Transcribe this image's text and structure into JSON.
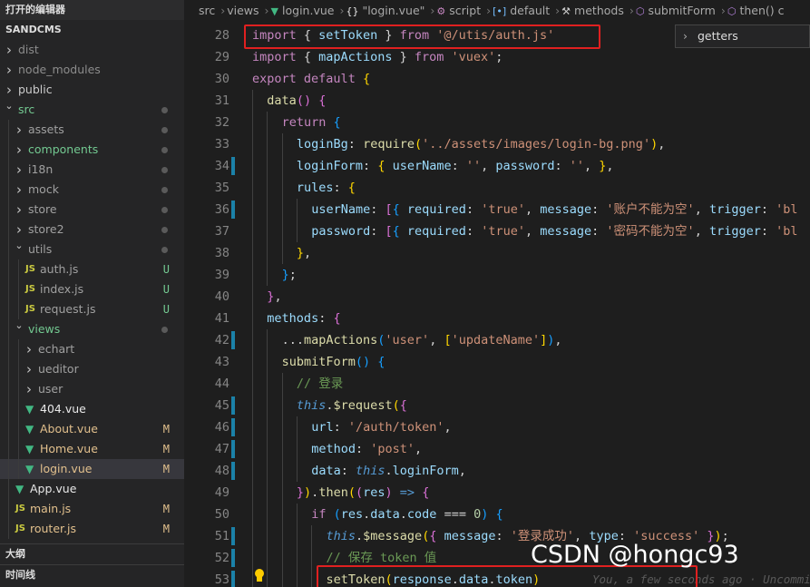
{
  "sidebar": {
    "open_editors": "打开的编辑器",
    "project": "SANDCMS",
    "items": [
      {
        "label": "dist",
        "kind": "folder",
        "depth": 0,
        "open": false,
        "color": "#8c8c8c",
        "status": ""
      },
      {
        "label": "node_modules",
        "kind": "folder",
        "depth": 0,
        "open": false,
        "color": "#8c8c8c",
        "status": ""
      },
      {
        "label": "public",
        "kind": "folder",
        "depth": 0,
        "open": false,
        "color": "#cccccc",
        "status": ""
      },
      {
        "label": "src",
        "kind": "folder",
        "depth": 0,
        "open": true,
        "color": "#73c991",
        "status": "dot"
      },
      {
        "label": "assets",
        "kind": "folder",
        "depth": 1,
        "open": false,
        "color": "#a0a0a0",
        "status": "dot"
      },
      {
        "label": "components",
        "kind": "folder",
        "depth": 1,
        "open": false,
        "color": "#73c991",
        "status": "dot"
      },
      {
        "label": "i18n",
        "kind": "folder",
        "depth": 1,
        "open": false,
        "color": "#a0a0a0",
        "status": "dot"
      },
      {
        "label": "mock",
        "kind": "folder",
        "depth": 1,
        "open": false,
        "color": "#a0a0a0",
        "status": "dot"
      },
      {
        "label": "store",
        "kind": "folder",
        "depth": 1,
        "open": false,
        "color": "#a0a0a0",
        "status": "dot"
      },
      {
        "label": "store2",
        "kind": "folder",
        "depth": 1,
        "open": false,
        "color": "#a0a0a0",
        "status": "dot"
      },
      {
        "label": "utils",
        "kind": "folder",
        "depth": 1,
        "open": true,
        "color": "#a0a0a0",
        "status": "dot"
      },
      {
        "label": "auth.js",
        "kind": "js",
        "depth": 2,
        "color": "#a0a0a0",
        "status": "U"
      },
      {
        "label": "index.js",
        "kind": "js",
        "depth": 2,
        "color": "#a0a0a0",
        "status": "U"
      },
      {
        "label": "request.js",
        "kind": "js",
        "depth": 2,
        "color": "#a0a0a0",
        "status": "U"
      },
      {
        "label": "views",
        "kind": "folder",
        "depth": 1,
        "open": true,
        "color": "#73c991",
        "status": "dot"
      },
      {
        "label": "echart",
        "kind": "folder",
        "depth": 2,
        "open": false,
        "color": "#a0a0a0",
        "status": ""
      },
      {
        "label": "ueditor",
        "kind": "folder",
        "depth": 2,
        "open": false,
        "color": "#a0a0a0",
        "status": ""
      },
      {
        "label": "user",
        "kind": "folder",
        "depth": 2,
        "open": false,
        "color": "#a0a0a0",
        "status": ""
      },
      {
        "label": "404.vue",
        "kind": "vue",
        "depth": 2,
        "color": "#e8e8e8",
        "status": ""
      },
      {
        "label": "About.vue",
        "kind": "vue",
        "depth": 2,
        "color": "#e2c08d",
        "status": "M"
      },
      {
        "label": "Home.vue",
        "kind": "vue",
        "depth": 2,
        "color": "#e2c08d",
        "status": "M"
      },
      {
        "label": "login.vue",
        "kind": "vue",
        "depth": 2,
        "color": "#e2c08d",
        "status": "M",
        "selected": true
      },
      {
        "label": "App.vue",
        "kind": "vue",
        "depth": 1,
        "color": "#e8e8e8",
        "status": ""
      },
      {
        "label": "main.js",
        "kind": "js",
        "depth": 1,
        "color": "#e2c08d",
        "status": "M"
      },
      {
        "label": "router.js",
        "kind": "js",
        "depth": 1,
        "color": "#e2c08d",
        "status": "M"
      }
    ],
    "outline": "大纲",
    "timeline": "时间线",
    "status_colors": {
      "U": "#73c991",
      "M": "#e2c08d"
    }
  },
  "breadcrumb": {
    "items": [
      {
        "text": "src",
        "icon": ""
      },
      {
        "text": "views",
        "icon": ""
      },
      {
        "text": "login.vue",
        "icon": "vue-icon"
      },
      {
        "text": "\"login.vue\"",
        "icon": "braces-icon"
      },
      {
        "text": "script",
        "icon": "script-icon"
      },
      {
        "text": "default",
        "icon": "object-icon"
      },
      {
        "text": "methods",
        "icon": "wrench-icon"
      },
      {
        "text": "submitForm",
        "icon": "cube-icon"
      },
      {
        "text": "then() c",
        "icon": "cube-icon"
      }
    ]
  },
  "suggest": {
    "label": "getters"
  },
  "editor": {
    "lines": [
      {
        "n": 28,
        "indent": 0,
        "mod": false,
        "t": [
          [
            "kw",
            "import"
          ],
          [
            "pun",
            " { "
          ],
          [
            "va",
            "setToken"
          ],
          [
            "pun",
            " } "
          ],
          [
            "kw",
            "from"
          ],
          [
            "pun",
            " "
          ],
          [
            "str",
            "'@/utis/auth.js'"
          ]
        ]
      },
      {
        "n": 29,
        "indent": 0,
        "mod": false,
        "t": [
          [
            "kw",
            "import"
          ],
          [
            "pun",
            " { "
          ],
          [
            "va",
            "mapActions"
          ],
          [
            "pun",
            " } "
          ],
          [
            "kw",
            "from"
          ],
          [
            "pun",
            " "
          ],
          [
            "str",
            "'vuex'"
          ],
          [
            "pun",
            ";"
          ]
        ]
      },
      {
        "n": 30,
        "indent": 0,
        "mod": false,
        "t": [
          [
            "kw",
            "export"
          ],
          [
            "pun",
            " "
          ],
          [
            "kw",
            "default"
          ],
          [
            "pun",
            " "
          ],
          [
            "br1",
            "{"
          ]
        ]
      },
      {
        "n": 31,
        "indent": 1,
        "mod": false,
        "t": [
          [
            "fn",
            "data"
          ],
          [
            "br2",
            "()"
          ],
          [
            "pun",
            " "
          ],
          [
            "br2",
            "{"
          ]
        ]
      },
      {
        "n": 32,
        "indent": 2,
        "mod": false,
        "t": [
          [
            "kw",
            "return"
          ],
          [
            "pun",
            " "
          ],
          [
            "br3",
            "{"
          ]
        ]
      },
      {
        "n": 33,
        "indent": 3,
        "mod": false,
        "t": [
          [
            "va",
            "loginBg"
          ],
          [
            "pun",
            ": "
          ],
          [
            "fn",
            "require"
          ],
          [
            "br1",
            "("
          ],
          [
            "str",
            "'../assets/images/login-bg.png'"
          ],
          [
            "br1",
            ")"
          ],
          [
            "pun",
            ","
          ]
        ]
      },
      {
        "n": 34,
        "indent": 3,
        "mod": true,
        "t": [
          [
            "va",
            "loginForm"
          ],
          [
            "pun",
            ": "
          ],
          [
            "br1",
            "{"
          ],
          [
            "pun",
            " "
          ],
          [
            "va",
            "userName"
          ],
          [
            "pun",
            ": "
          ],
          [
            "str",
            "''"
          ],
          [
            "pun",
            ", "
          ],
          [
            "va",
            "password"
          ],
          [
            "pun",
            ": "
          ],
          [
            "str",
            "''"
          ],
          [
            "pun",
            ", "
          ],
          [
            "br1",
            "}"
          ],
          [
            "pun",
            ","
          ]
        ]
      },
      {
        "n": 35,
        "indent": 3,
        "mod": false,
        "t": [
          [
            "va",
            "rules"
          ],
          [
            "pun",
            ": "
          ],
          [
            "br1",
            "{"
          ]
        ]
      },
      {
        "n": 36,
        "indent": 4,
        "mod": true,
        "t": [
          [
            "va",
            "userName"
          ],
          [
            "pun",
            ": "
          ],
          [
            "br2",
            "["
          ],
          [
            "br3",
            "{"
          ],
          [
            "pun",
            " "
          ],
          [
            "va",
            "required"
          ],
          [
            "pun",
            ": "
          ],
          [
            "str",
            "'true'"
          ],
          [
            "pun",
            ", "
          ],
          [
            "va",
            "message"
          ],
          [
            "pun",
            ": "
          ],
          [
            "str",
            "'账户不能为空'"
          ],
          [
            "pun",
            ", "
          ],
          [
            "va",
            "trigger"
          ],
          [
            "pun",
            ": "
          ],
          [
            "str",
            "'bl"
          ]
        ]
      },
      {
        "n": 37,
        "indent": 4,
        "mod": false,
        "t": [
          [
            "va",
            "password"
          ],
          [
            "pun",
            ": "
          ],
          [
            "br2",
            "["
          ],
          [
            "br3",
            "{"
          ],
          [
            "pun",
            " "
          ],
          [
            "va",
            "required"
          ],
          [
            "pun",
            ": "
          ],
          [
            "str",
            "'true'"
          ],
          [
            "pun",
            ", "
          ],
          [
            "va",
            "message"
          ],
          [
            "pun",
            ": "
          ],
          [
            "str",
            "'密码不能为空'"
          ],
          [
            "pun",
            ", "
          ],
          [
            "va",
            "trigger"
          ],
          [
            "pun",
            ": "
          ],
          [
            "str",
            "'bl"
          ]
        ]
      },
      {
        "n": 38,
        "indent": 3,
        "mod": false,
        "t": [
          [
            "br1",
            "}"
          ],
          [
            "pun",
            ","
          ]
        ]
      },
      {
        "n": 39,
        "indent": 2,
        "mod": false,
        "t": [
          [
            "br3",
            "}"
          ],
          [
            "pun",
            ";"
          ]
        ]
      },
      {
        "n": 40,
        "indent": 1,
        "mod": false,
        "t": [
          [
            "br2",
            "}"
          ],
          [
            "pun",
            ","
          ]
        ]
      },
      {
        "n": 41,
        "indent": 1,
        "mod": false,
        "t": [
          [
            "va",
            "methods"
          ],
          [
            "pun",
            ": "
          ],
          [
            "br2",
            "{"
          ]
        ]
      },
      {
        "n": 42,
        "indent": 2,
        "mod": true,
        "t": [
          [
            "pun",
            "..."
          ],
          [
            "fn",
            "mapActions"
          ],
          [
            "br3",
            "("
          ],
          [
            "str",
            "'user'"
          ],
          [
            "pun",
            ", "
          ],
          [
            "br1",
            "["
          ],
          [
            "str",
            "'updateName'"
          ],
          [
            "br1",
            "]"
          ],
          [
            "br3",
            ")"
          ],
          [
            "pun",
            ","
          ]
        ]
      },
      {
        "n": 43,
        "indent": 2,
        "mod": false,
        "t": [
          [
            "fn",
            "submitForm"
          ],
          [
            "br3",
            "()"
          ],
          [
            "pun",
            " "
          ],
          [
            "br3",
            "{"
          ]
        ]
      },
      {
        "n": 44,
        "indent": 3,
        "mod": false,
        "t": [
          [
            "cm",
            "// 登录"
          ]
        ]
      },
      {
        "n": 45,
        "indent": 3,
        "mod": true,
        "t": [
          [
            "this",
            "this"
          ],
          [
            "pun",
            "."
          ],
          [
            "fn",
            "$request"
          ],
          [
            "br1",
            "("
          ],
          [
            "br2",
            "{"
          ]
        ]
      },
      {
        "n": 46,
        "indent": 4,
        "mod": true,
        "t": [
          [
            "va",
            "url"
          ],
          [
            "pun",
            ": "
          ],
          [
            "str",
            "'/auth/token'"
          ],
          [
            "pun",
            ","
          ]
        ]
      },
      {
        "n": 47,
        "indent": 4,
        "mod": true,
        "t": [
          [
            "va",
            "method"
          ],
          [
            "pun",
            ": "
          ],
          [
            "str",
            "'post'"
          ],
          [
            "pun",
            ","
          ]
        ]
      },
      {
        "n": 48,
        "indent": 4,
        "mod": true,
        "t": [
          [
            "va",
            "data"
          ],
          [
            "pun",
            ": "
          ],
          [
            "this",
            "this"
          ],
          [
            "pun",
            "."
          ],
          [
            "va",
            "loginForm"
          ],
          [
            "pun",
            ","
          ]
        ]
      },
      {
        "n": 49,
        "indent": 3,
        "mod": false,
        "t": [
          [
            "br2",
            "}"
          ],
          [
            "br1",
            ")"
          ],
          [
            "pun",
            "."
          ],
          [
            "fn",
            "then"
          ],
          [
            "br1",
            "("
          ],
          [
            "br2",
            "("
          ],
          [
            "va",
            "res"
          ],
          [
            "br2",
            ")"
          ],
          [
            "pun",
            " "
          ],
          [
            "bl",
            "=>"
          ],
          [
            "pun",
            " "
          ],
          [
            "br2",
            "{"
          ]
        ]
      },
      {
        "n": 50,
        "indent": 4,
        "mod": false,
        "t": [
          [
            "kw",
            "if"
          ],
          [
            "pun",
            " "
          ],
          [
            "br3",
            "("
          ],
          [
            "va",
            "res"
          ],
          [
            "pun",
            "."
          ],
          [
            "va",
            "data"
          ],
          [
            "pun",
            "."
          ],
          [
            "va",
            "code"
          ],
          [
            "pun",
            " === "
          ],
          [
            "num",
            "0"
          ],
          [
            "br3",
            ")"
          ],
          [
            "pun",
            " "
          ],
          [
            "br3",
            "{"
          ]
        ]
      },
      {
        "n": 51,
        "indent": 5,
        "mod": true,
        "t": [
          [
            "this",
            "this"
          ],
          [
            "pun",
            "."
          ],
          [
            "fn",
            "$message"
          ],
          [
            "br1",
            "("
          ],
          [
            "br2",
            "{"
          ],
          [
            "pun",
            " "
          ],
          [
            "va",
            "message"
          ],
          [
            "pun",
            ": "
          ],
          [
            "str",
            "'登录成功'"
          ],
          [
            "pun",
            ", "
          ],
          [
            "va",
            "type"
          ],
          [
            "pun",
            ": "
          ],
          [
            "str",
            "'success'"
          ],
          [
            "pun",
            " "
          ],
          [
            "br2",
            "}"
          ],
          [
            "br1",
            ")"
          ],
          [
            "pun",
            ";"
          ]
        ]
      },
      {
        "n": 52,
        "indent": 5,
        "mod": true,
        "t": [
          [
            "cm",
            "// 保存 token 值"
          ]
        ]
      },
      {
        "n": 53,
        "indent": 5,
        "mod": true,
        "t": [
          [
            "fn",
            "setToken"
          ],
          [
            "br1",
            "("
          ],
          [
            "va",
            "response"
          ],
          [
            "pun",
            "."
          ],
          [
            "va",
            "data"
          ],
          [
            "pun",
            "."
          ],
          [
            "va",
            "token"
          ],
          [
            "br1",
            ")"
          ]
        ]
      }
    ],
    "ghost_text": "You, a few seconds ago · Uncommitted"
  },
  "watermark": "CSDN @hongc93",
  "colors": {
    "highlight_box": "#e02020",
    "gutter_modified": "#1b81a8"
  }
}
